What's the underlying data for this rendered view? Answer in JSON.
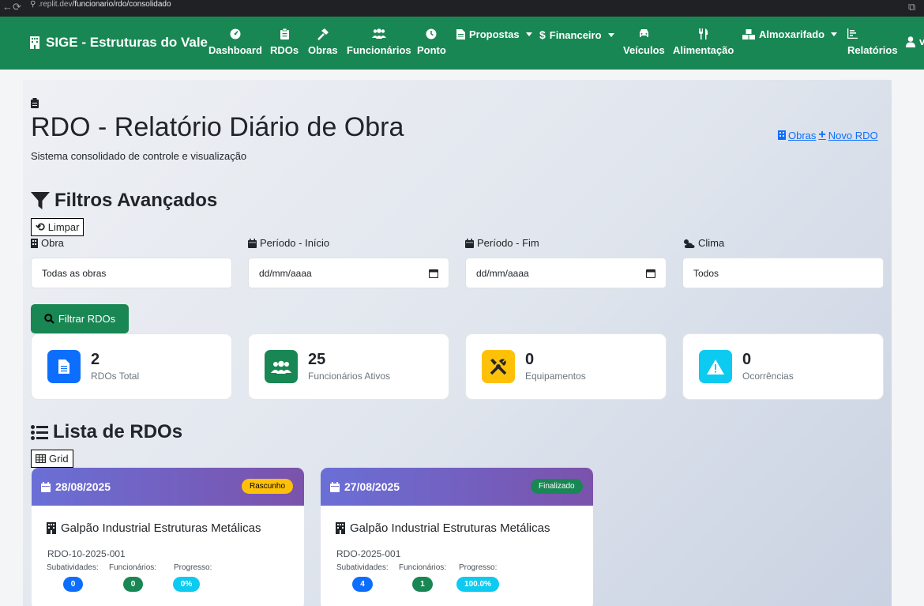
{
  "browser": {
    "url_prefix": ".replit.dev",
    "url_path": "/funcionario/rdo/consolidado"
  },
  "nav": {
    "brand": "SIGE - Estruturas do Vale",
    "items": [
      "Dashboard",
      "RDOs",
      "Obras",
      "Funcionários",
      "Ponto",
      "Veículos",
      "Alimentação",
      "Relatórios"
    ],
    "dropdowns": [
      "Propostas",
      "Financeiro",
      "Almoxarifado"
    ],
    "user_initial": "v"
  },
  "header": {
    "title": "RDO - Relatório Diário de Obra",
    "subtitle": "Sistema consolidado de controle e visualização",
    "link_obras": "Obras",
    "link_novo": "Novo RDO"
  },
  "filters": {
    "title": "Filtros Avançados",
    "clear_label": "Limpar",
    "obra_label": "Obra",
    "obra_value": "Todas as obras",
    "inicio_label": "Período - Início",
    "inicio_placeholder": "dd/mm/aaaa",
    "fim_label": "Período - Fim",
    "fim_placeholder": "dd/mm/aaaa",
    "clima_label": "Clima",
    "clima_value": "Todos",
    "submit_label": "Filtrar RDOs"
  },
  "stats": [
    {
      "value": "2",
      "label": "RDOs Total",
      "color": "#0d6efd"
    },
    {
      "value": "25",
      "label": "Funcionários Ativos",
      "color": "#198754"
    },
    {
      "value": "0",
      "label": "Equipamentos",
      "color": "#ffc107"
    },
    {
      "value": "0",
      "label": "Ocorrências",
      "color": "#0dcaf0"
    }
  ],
  "list": {
    "title": "Lista de RDOs",
    "view_label": "Grid",
    "meta_labels": [
      "Subatividades:",
      "Funcionários:",
      "Progresso:"
    ],
    "cards": [
      {
        "date": "28/08/2025",
        "status": "Rascunho",
        "status_color": "#ffc107",
        "obra": "Galpão Industrial Estruturas Metálicas",
        "code": "RDO-10-2025-001",
        "subatividades": "0",
        "funcionarios": "0",
        "progresso": "0%"
      },
      {
        "date": "27/08/2025",
        "status": "Finalizado",
        "status_color": "#198754",
        "obra": "Galpão Industrial Estruturas Metálicas",
        "code": "RDO-2025-001",
        "subatividades": "4",
        "funcionarios": "1",
        "progresso": "100.0%"
      }
    ]
  }
}
